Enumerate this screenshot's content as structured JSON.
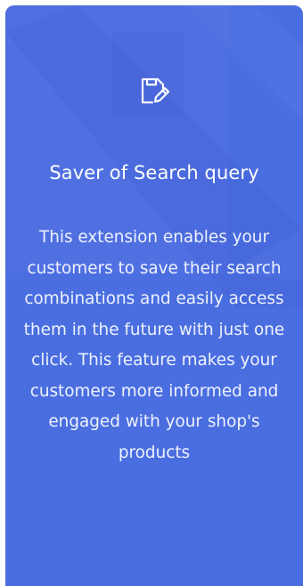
{
  "card": {
    "icon": "save-edit-icon",
    "title": "Saver of Search query",
    "description": "This extension enables your customers to save their search combinations and easily access them in the future with just one click. This feature makes your customers more informed and engaged with your shop's products"
  },
  "colors": {
    "card_background": "#4a6ee0",
    "text": "#ffffff"
  }
}
